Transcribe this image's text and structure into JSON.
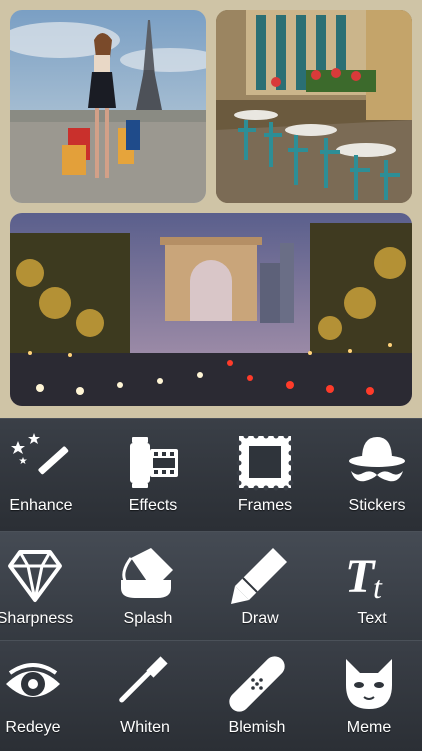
{
  "theme": {
    "collage_border": "#cfc4a6",
    "toolbar_bg": "#2f343b",
    "label_color": "#ffffff"
  },
  "collage": {
    "photos": [
      {
        "id": "paris-shopper",
        "subject": "woman with shopping bags near the Eiffel Tower"
      },
      {
        "id": "cafe-terrace",
        "subject": "Parisian cafe terrace with teal chairs"
      },
      {
        "id": "champs-elysees",
        "subject": "Arc de Triomphe at dusk with traffic lights"
      }
    ]
  },
  "toolbar": {
    "rows": [
      [
        {
          "label": "Enhance",
          "icon": "magic-wand-icon"
        },
        {
          "label": "Effects",
          "icon": "film-roll-icon"
        },
        {
          "label": "Frames",
          "icon": "frame-icon"
        },
        {
          "label": "Stickers",
          "icon": "hat-mustache-icon"
        }
      ],
      [
        {
          "label": "Sharpness",
          "icon": "diamond-icon"
        },
        {
          "label": "Splash",
          "icon": "paint-bucket-icon"
        },
        {
          "label": "Draw",
          "icon": "pencil-icon"
        },
        {
          "label": "Text",
          "icon": "text-icon"
        }
      ],
      [
        {
          "label": "Redeye",
          "icon": "eye-icon"
        },
        {
          "label": "Whiten",
          "icon": "toothbrush-icon"
        },
        {
          "label": "Blemish",
          "icon": "bandage-icon"
        },
        {
          "label": "Meme",
          "icon": "cat-face-icon"
        }
      ]
    ]
  }
}
